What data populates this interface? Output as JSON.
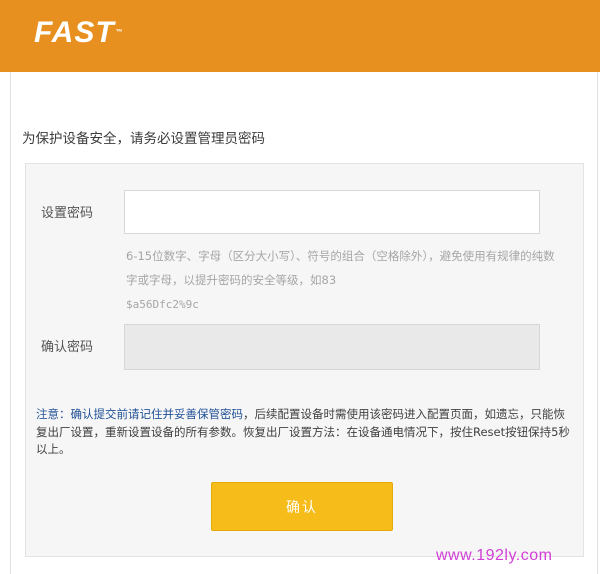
{
  "header": {
    "logo_text": "FAST",
    "logo_mark": "™",
    "brand_color": "#e8901f"
  },
  "headline": "为保护设备安全，请务必设置管理员密码",
  "form": {
    "password_label": "设置密码",
    "password_value": "",
    "hint_text": "6-15位数字、字母（区分大小写）、符号的组合（空格除外），避免使用有规律的纯数字或字母，以提升密码的安全等级，如83",
    "hint_example": "$a56Dfc2%9c",
    "confirm_label": "确认密码",
    "confirm_value": ""
  },
  "note": {
    "label": "注意：",
    "emphasis": "确认提交前请记住并妥善保管密码",
    "body": "，后续配置设备时需使用该密码进入配置页面，如遗忘，只能恢复出厂设置，重新设置设备的所有参数。恢复出厂设置方法：在设备通电情况下，按住Reset按钮保持5秒以上。"
  },
  "confirm_button": {
    "label": "确认",
    "color": "#f5bc1a"
  },
  "watermark": "www.192ly.com"
}
